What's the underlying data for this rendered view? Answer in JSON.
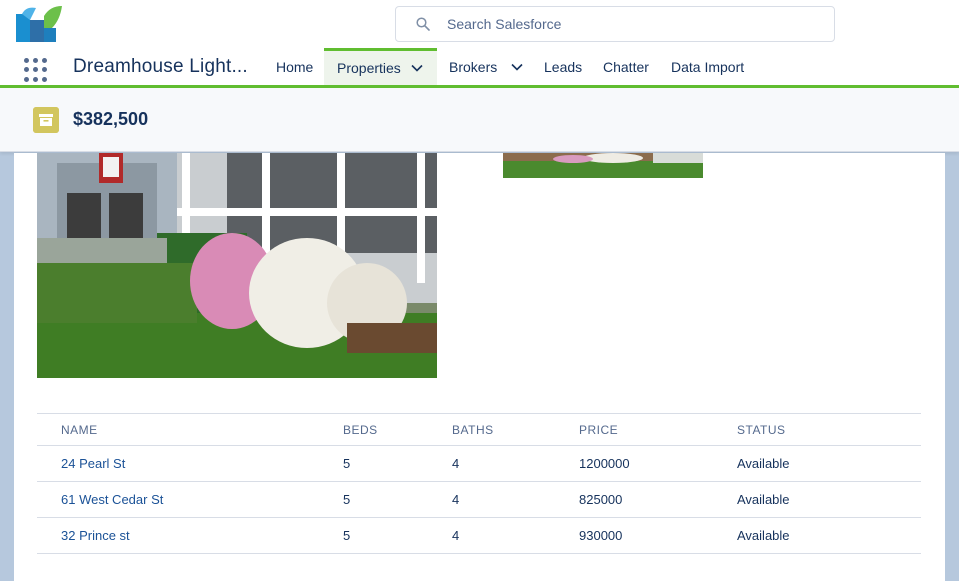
{
  "header": {
    "search_placeholder": "Search Salesforce"
  },
  "nav": {
    "app_name": "Dreamhouse Light...",
    "items": [
      {
        "label": "Home"
      },
      {
        "label": "Properties"
      },
      {
        "label": "Brokers"
      },
      {
        "label": "Leads"
      },
      {
        "label": "Chatter"
      },
      {
        "label": "Data Import"
      }
    ],
    "active": "Properties"
  },
  "record": {
    "title": "$382,500",
    "icon": "archive-icon"
  },
  "table": {
    "columns": [
      "NAME",
      "BEDS",
      "BATHS",
      "PRICE",
      "STATUS"
    ],
    "rows": [
      {
        "name": "24 Pearl St",
        "beds": "5",
        "baths": "4",
        "price": "1200000",
        "status": "Available"
      },
      {
        "name": "61 West Cedar St",
        "beds": "5",
        "baths": "4",
        "price": "825000",
        "status": "Available"
      },
      {
        "name": "32 Prince st",
        "beds": "5",
        "baths": "4",
        "price": "930000",
        "status": "Available"
      }
    ]
  },
  "colors": {
    "accent_green": "#60bd30",
    "link_blue": "#1b5297",
    "record_icon": "#d2c65e",
    "page_bg": "#b6c8dd"
  }
}
